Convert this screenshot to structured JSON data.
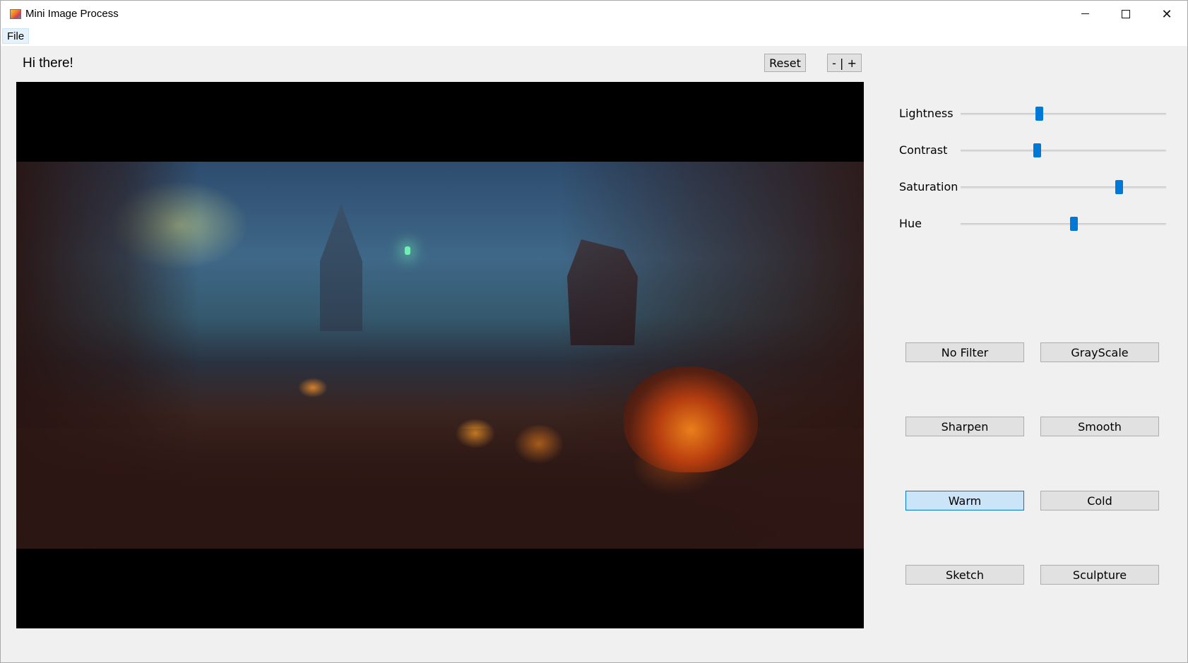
{
  "window": {
    "title": "Mini Image Process",
    "minimize_icon": "minimize-icon",
    "maximize_icon": "maximize-icon",
    "close_icon": "close-icon",
    "close_glyph": "✕"
  },
  "menubar": {
    "items": [
      {
        "label": "File"
      }
    ]
  },
  "header": {
    "greeting": "Hi there!",
    "reset_label": "Reset",
    "zoom_label": "- | +"
  },
  "sliders": [
    {
      "label": "Lightness",
      "value": 0.38
    },
    {
      "label": "Contrast",
      "value": 0.37
    },
    {
      "label": "Saturation",
      "value": 0.77
    },
    {
      "label": "Hue",
      "value": 0.55
    }
  ],
  "filters": [
    {
      "label": "No Filter",
      "active": false
    },
    {
      "label": "GrayScale",
      "active": false
    },
    {
      "label": "Sharpen",
      "active": false
    },
    {
      "label": "Smooth",
      "active": false
    },
    {
      "label": "Warm",
      "active": true
    },
    {
      "label": "Cold",
      "active": false
    },
    {
      "label": "Sketch",
      "active": false
    },
    {
      "label": "Sculpture",
      "active": false
    }
  ],
  "colors": {
    "accent": "#0078d7",
    "active_button_bg": "#cce4f7",
    "button_bg": "#e1e1e1",
    "window_bg": "#f0f0f0"
  }
}
